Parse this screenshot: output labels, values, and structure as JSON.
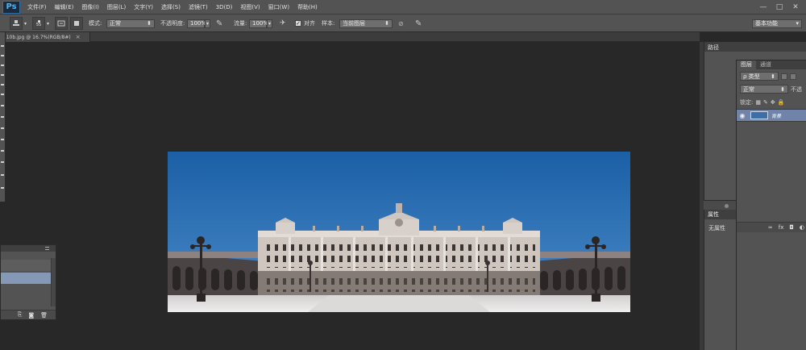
{
  "app": {
    "logo": "Ps"
  },
  "menu": [
    "文件(F)",
    "编辑(E)",
    "图像(I)",
    "图层(L)",
    "文字(Y)",
    "选择(S)",
    "滤镜(T)",
    "3D(D)",
    "视图(V)",
    "窗口(W)",
    "帮助(H)"
  ],
  "window_controls": {
    "minimize": "—",
    "maximize": "□",
    "close": "✕"
  },
  "options": {
    "brush_size": "55",
    "mode_label": "模式:",
    "mode_value": "正常",
    "opacity_label": "不透明度:",
    "opacity_value": "100%",
    "flow_label": "流量:",
    "flow_value": "100%",
    "align_label": "对齐",
    "align_checked": true,
    "sample_label": "样本:",
    "sample_value": "当前图层",
    "workspace": "基本功能"
  },
  "document": {
    "tab_title": "7.10b.jpg @ 16.7%(RGB/8#)",
    "close": "×"
  },
  "panels": {
    "paths_title": "路径",
    "layers_tab": "图层",
    "channels_tab": "通道",
    "filter_kind": "ρ 类型",
    "blend_mode": "正常",
    "opacity_short": "不透",
    "lock_label": "锁定:",
    "layer_name": "背景",
    "properties_title": "属性",
    "properties_empty": "无属性"
  },
  "colors": {
    "sky_top": "#1b5fa6",
    "sky_bottom": "#4a8bc8",
    "selected_layer": "#6f84a8"
  }
}
